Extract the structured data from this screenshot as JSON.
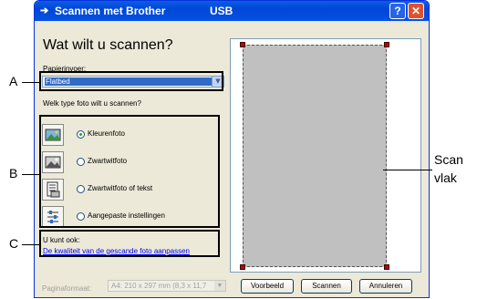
{
  "window": {
    "title": "Scannen met Brother",
    "title_suffix": "USB",
    "help_label": "?",
    "close_label": "✕"
  },
  "main": {
    "heading": "Wat wilt u scannen?",
    "paper_feed_label": "Papierinvoer:",
    "paper_feed_value": "Flatbed",
    "photo_type_question": "Welk type foto wilt u scannen?"
  },
  "options": [
    {
      "label": "Kleurenfoto",
      "selected": true,
      "icon": "color-photo-icon"
    },
    {
      "label": "Zwartwitfoto",
      "selected": false,
      "icon": "bw-photo-icon"
    },
    {
      "label": "Zwartwitfoto of tekst",
      "selected": false,
      "icon": "text-document-icon"
    },
    {
      "label": "Aangepaste instellingen",
      "selected": false,
      "icon": "custom-settings-icon"
    }
  ],
  "extra": {
    "label": "U kunt ook:",
    "link": "De kwaliteit van de gescande foto aanpassen"
  },
  "footer": {
    "format_label": "Paginaformaat:",
    "format_value": "A4: 210 x 297 mm (8,3 x 11,7",
    "preview_button": "Voorbeeld",
    "scan_button": "Scannen",
    "cancel_button": "Annuleren"
  },
  "annotations": {
    "a": "A",
    "b": "B",
    "c": "C",
    "scan_line1": "Scan",
    "scan_line2": "vlak"
  },
  "colors": {
    "titlebar": "#0a5ee8",
    "selection": "#316ac5",
    "scan_area": "#c0c0c0",
    "corner_handle": "#a01010"
  }
}
